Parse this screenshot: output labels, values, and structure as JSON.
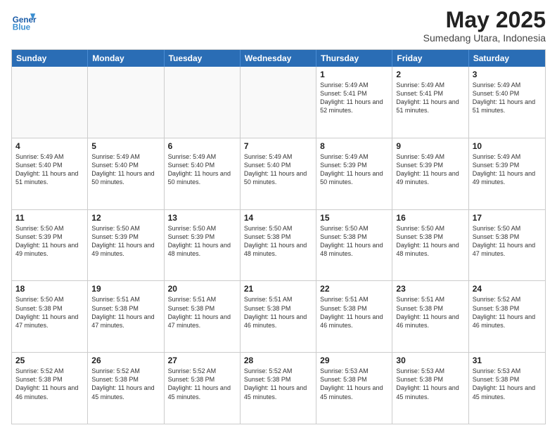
{
  "logo": {
    "text_general": "General",
    "text_blue": "Blue"
  },
  "header": {
    "month_year": "May 2025",
    "location": "Sumedang Utara, Indonesia"
  },
  "days_of_week": [
    "Sunday",
    "Monday",
    "Tuesday",
    "Wednesday",
    "Thursday",
    "Friday",
    "Saturday"
  ],
  "weeks": [
    [
      {
        "day": "",
        "empty": true
      },
      {
        "day": "",
        "empty": true
      },
      {
        "day": "",
        "empty": true
      },
      {
        "day": "",
        "empty": true
      },
      {
        "day": "1",
        "sunrise": "5:49 AM",
        "sunset": "5:41 PM",
        "daylight": "11 hours and 52 minutes."
      },
      {
        "day": "2",
        "sunrise": "5:49 AM",
        "sunset": "5:41 PM",
        "daylight": "11 hours and 51 minutes."
      },
      {
        "day": "3",
        "sunrise": "5:49 AM",
        "sunset": "5:40 PM",
        "daylight": "11 hours and 51 minutes."
      }
    ],
    [
      {
        "day": "4",
        "sunrise": "5:49 AM",
        "sunset": "5:40 PM",
        "daylight": "11 hours and 51 minutes."
      },
      {
        "day": "5",
        "sunrise": "5:49 AM",
        "sunset": "5:40 PM",
        "daylight": "11 hours and 50 minutes."
      },
      {
        "day": "6",
        "sunrise": "5:49 AM",
        "sunset": "5:40 PM",
        "daylight": "11 hours and 50 minutes."
      },
      {
        "day": "7",
        "sunrise": "5:49 AM",
        "sunset": "5:40 PM",
        "daylight": "11 hours and 50 minutes."
      },
      {
        "day": "8",
        "sunrise": "5:49 AM",
        "sunset": "5:39 PM",
        "daylight": "11 hours and 50 minutes."
      },
      {
        "day": "9",
        "sunrise": "5:49 AM",
        "sunset": "5:39 PM",
        "daylight": "11 hours and 49 minutes."
      },
      {
        "day": "10",
        "sunrise": "5:49 AM",
        "sunset": "5:39 PM",
        "daylight": "11 hours and 49 minutes."
      }
    ],
    [
      {
        "day": "11",
        "sunrise": "5:50 AM",
        "sunset": "5:39 PM",
        "daylight": "11 hours and 49 minutes."
      },
      {
        "day": "12",
        "sunrise": "5:50 AM",
        "sunset": "5:39 PM",
        "daylight": "11 hours and 49 minutes."
      },
      {
        "day": "13",
        "sunrise": "5:50 AM",
        "sunset": "5:39 PM",
        "daylight": "11 hours and 48 minutes."
      },
      {
        "day": "14",
        "sunrise": "5:50 AM",
        "sunset": "5:38 PM",
        "daylight": "11 hours and 48 minutes."
      },
      {
        "day": "15",
        "sunrise": "5:50 AM",
        "sunset": "5:38 PM",
        "daylight": "11 hours and 48 minutes."
      },
      {
        "day": "16",
        "sunrise": "5:50 AM",
        "sunset": "5:38 PM",
        "daylight": "11 hours and 48 minutes."
      },
      {
        "day": "17",
        "sunrise": "5:50 AM",
        "sunset": "5:38 PM",
        "daylight": "11 hours and 47 minutes."
      }
    ],
    [
      {
        "day": "18",
        "sunrise": "5:50 AM",
        "sunset": "5:38 PM",
        "daylight": "11 hours and 47 minutes."
      },
      {
        "day": "19",
        "sunrise": "5:51 AM",
        "sunset": "5:38 PM",
        "daylight": "11 hours and 47 minutes."
      },
      {
        "day": "20",
        "sunrise": "5:51 AM",
        "sunset": "5:38 PM",
        "daylight": "11 hours and 47 minutes."
      },
      {
        "day": "21",
        "sunrise": "5:51 AM",
        "sunset": "5:38 PM",
        "daylight": "11 hours and 46 minutes."
      },
      {
        "day": "22",
        "sunrise": "5:51 AM",
        "sunset": "5:38 PM",
        "daylight": "11 hours and 46 minutes."
      },
      {
        "day": "23",
        "sunrise": "5:51 AM",
        "sunset": "5:38 PM",
        "daylight": "11 hours and 46 minutes."
      },
      {
        "day": "24",
        "sunrise": "5:52 AM",
        "sunset": "5:38 PM",
        "daylight": "11 hours and 46 minutes."
      }
    ],
    [
      {
        "day": "25",
        "sunrise": "5:52 AM",
        "sunset": "5:38 PM",
        "daylight": "11 hours and 46 minutes."
      },
      {
        "day": "26",
        "sunrise": "5:52 AM",
        "sunset": "5:38 PM",
        "daylight": "11 hours and 45 minutes."
      },
      {
        "day": "27",
        "sunrise": "5:52 AM",
        "sunset": "5:38 PM",
        "daylight": "11 hours and 45 minutes."
      },
      {
        "day": "28",
        "sunrise": "5:52 AM",
        "sunset": "5:38 PM",
        "daylight": "11 hours and 45 minutes."
      },
      {
        "day": "29",
        "sunrise": "5:53 AM",
        "sunset": "5:38 PM",
        "daylight": "11 hours and 45 minutes."
      },
      {
        "day": "30",
        "sunrise": "5:53 AM",
        "sunset": "5:38 PM",
        "daylight": "11 hours and 45 minutes."
      },
      {
        "day": "31",
        "sunrise": "5:53 AM",
        "sunset": "5:38 PM",
        "daylight": "11 hours and 45 minutes."
      }
    ]
  ]
}
